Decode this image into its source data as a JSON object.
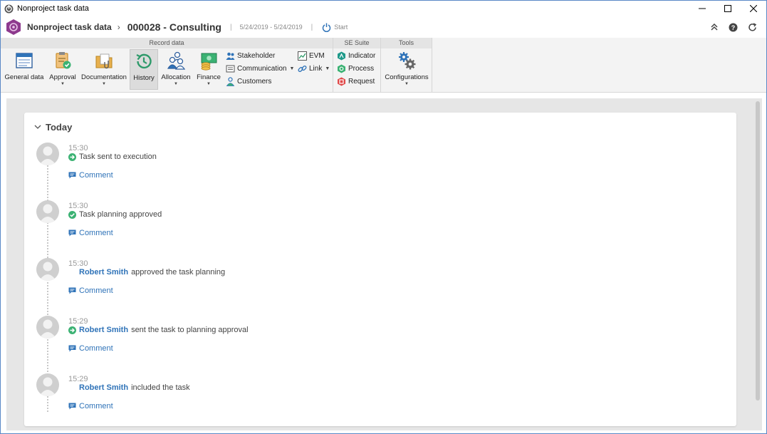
{
  "window": {
    "title": "Nonproject task data"
  },
  "header": {
    "module": "Nonproject task data",
    "record": "000028 - Consulting",
    "separator": "|",
    "dates": "5/24/2019 - 5/24/2019",
    "start_label": "Start"
  },
  "ribbon": {
    "groups": {
      "record_data": "Record data",
      "se_suite": "SE Suite",
      "tools": "Tools"
    },
    "buttons": {
      "general_data": "General data",
      "approval": "Approval",
      "documentation": "Documentation",
      "history": "History",
      "allocation": "Allocation",
      "finance": "Finance",
      "stakeholder": "Stakeholder",
      "communication": "Communication",
      "customers": "Customers",
      "evm": "EVM",
      "link": "Link",
      "indicator": "Indicator",
      "process": "Process",
      "request": "Request",
      "configurations": "Configurations"
    }
  },
  "timeline": {
    "group_label": "Today",
    "comment_label": "Comment",
    "entries": [
      {
        "time": "15:30",
        "status": "arrow",
        "user": "",
        "text": "Task sent to execution"
      },
      {
        "time": "15:30",
        "status": "check",
        "user": "",
        "text": "Task planning approved"
      },
      {
        "time": "15:30",
        "status": "none",
        "user": "Robert Smith",
        "text": "approved the task planning"
      },
      {
        "time": "15:29",
        "status": "arrow",
        "user": "Robert Smith",
        "text": "sent the task to planning approval"
      },
      {
        "time": "15:29",
        "status": "none",
        "user": "Robert Smith",
        "text": "included the task"
      }
    ]
  },
  "colors": {
    "accent": "#2f73b8",
    "status_green": "#3bb273",
    "logo_purple": "#8e3a8e"
  }
}
